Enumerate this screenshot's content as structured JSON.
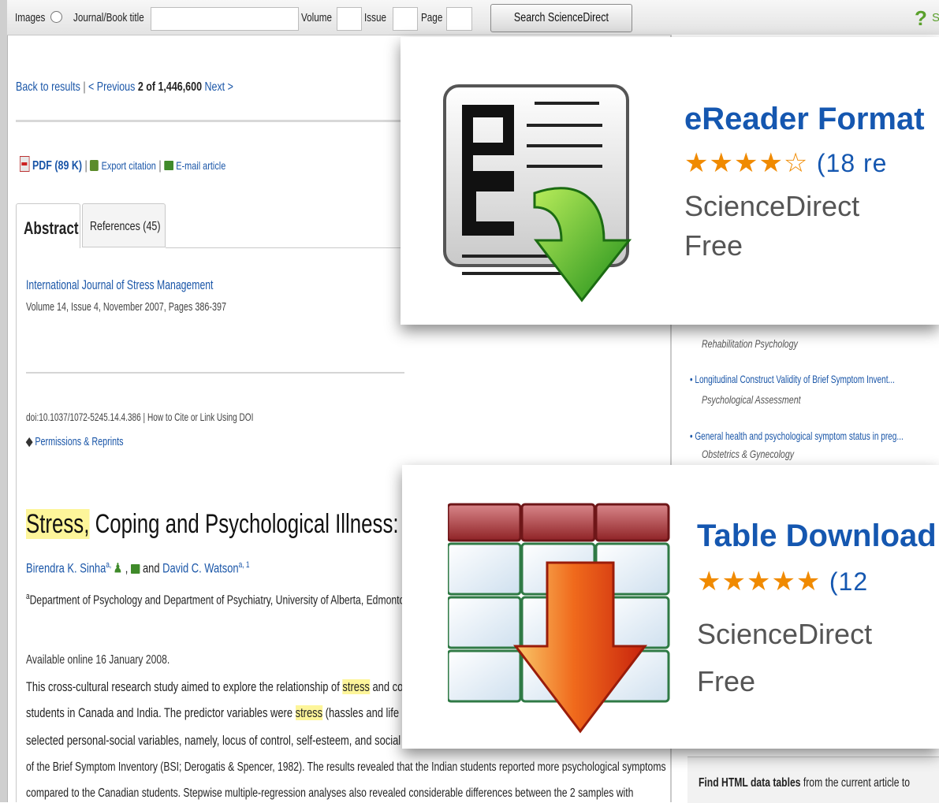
{
  "search_bar": {
    "images_label": "Images",
    "journal_label": "Journal/Book title",
    "journal_value": "",
    "volume_label": "Volume",
    "volume_value": "",
    "issue_label": "Issue",
    "issue_value": "",
    "page_label": "Page",
    "page_value": "",
    "search_button": "Search ScienceDirect",
    "help_icon": "?",
    "help_partial": "S"
  },
  "nav": {
    "back": "Back to results",
    "sep": "|",
    "previous": "< Previous",
    "position": "2 of 1,446,600",
    "next": "Next >"
  },
  "toolbar": {
    "pdf": "PDF (89 K)",
    "sep1": "|",
    "export": "Export citation",
    "sep2": "|",
    "email": "E-mail article"
  },
  "tabs": [
    {
      "label": "Abstract",
      "active": true
    },
    {
      "label": "References (45)",
      "active": false
    }
  ],
  "article": {
    "journal": "International Journal of Stress Management",
    "volume": "Volume 14, Issue 4, November 2007, Pages 386-397",
    "doi": "doi:10.1037/1072-5245.14.4.386 | How to Cite or Link Using DOI",
    "permissions": "Permissions & Reprints",
    "title_highlight": "Stress,",
    "title_rest": " Coping and Psychological Illness: A Cro",
    "author1": "Birendra K. Sinha",
    "author1_sup": "a, ",
    "and": "and",
    "author2": "David C. Watson",
    "author2_sup": "a, 1",
    "affil_sup": "a",
    "affiliation": "Department of Psychology and Department of Psychiatry, University of Alberta, Edmonto",
    "available": "Available online 16 January 2008.",
    "abstract_lines": [
      {
        "pre": "This cross-cultural research study aimed to explore the relationship of ",
        "hl": "stress",
        "post": " and copi"
      },
      {
        "pre": "students in Canada and India. The predictor variables were ",
        "hl": "stress",
        "post": " (hassles and life ex"
      },
      {
        "pre": "selected personal-social variables, namely, locus of control, self-esteem, and social sup",
        "hl": "",
        "post": ""
      },
      {
        "pre": "of the Brief Symptom Inventory (BSI; Derogatis & Spencer, 1982). The results revealed that the Indian students reported more psychological symptoms",
        "hl": "",
        "post": ""
      },
      {
        "pre": "compared to the Canadian students. Stepwise multiple-regression analyses also revealed considerable differences between the 2 samples with",
        "hl": "",
        "post": ""
      }
    ]
  },
  "sidebar": {
    "cut_item_source": "Rehabilitation Psychology",
    "items": [
      {
        "title": "Longitudinal Construct Validity of Brief Symptom Invent...",
        "source": "Psychological Assessment"
      },
      {
        "title": "General health and psychological symptom status in preg...",
        "source": "Obstetrics & Gynecology"
      }
    ],
    "find_bold": "Find HTML data tables",
    "find_rest": " from the current article to"
  },
  "cards": [
    {
      "icon": "ereader-icon",
      "title": "eReader Format",
      "stars": "★★★★☆",
      "rating": 4,
      "reviews": "(18 re",
      "publisher": "ScienceDirect",
      "price": "Free"
    },
    {
      "icon": "table-download-icon",
      "title": "Table Download",
      "stars": "★★★★★",
      "rating": 4.5,
      "reviews": "(12",
      "publisher": "ScienceDirect",
      "price": "Free"
    }
  ],
  "colors": {
    "link": "#1a56a8",
    "card_title": "#1557b0",
    "star": "#f08a00",
    "highlight": "#fdf59a"
  }
}
